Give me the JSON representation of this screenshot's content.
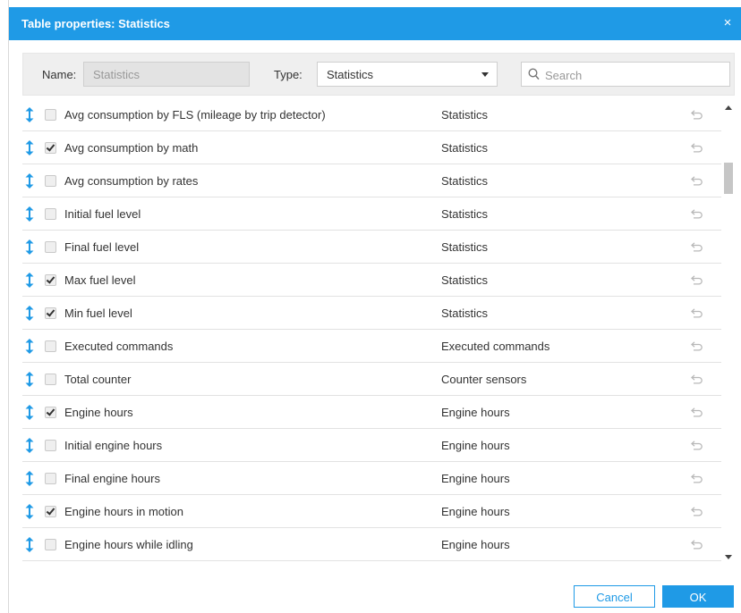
{
  "dialog": {
    "title": "Table properties: Statistics",
    "close_symbol": "×"
  },
  "filters": {
    "name_label": "Name:",
    "name_value": "Statistics",
    "type_label": "Type:",
    "type_value": "Statistics",
    "search_placeholder": "Search"
  },
  "rows": [
    {
      "name": "Avg consumption by FLS (mileage by trip detector)",
      "type": "Statistics",
      "checked": false
    },
    {
      "name": "Avg consumption by math",
      "type": "Statistics",
      "checked": true
    },
    {
      "name": "Avg consumption by rates",
      "type": "Statistics",
      "checked": false
    },
    {
      "name": "Initial fuel level",
      "type": "Statistics",
      "checked": false
    },
    {
      "name": "Final fuel level",
      "type": "Statistics",
      "checked": false
    },
    {
      "name": "Max fuel level",
      "type": "Statistics",
      "checked": true
    },
    {
      "name": "Min fuel level",
      "type": "Statistics",
      "checked": true
    },
    {
      "name": "Executed commands",
      "type": "Executed commands",
      "checked": false
    },
    {
      "name": "Total counter",
      "type": "Counter sensors",
      "checked": false
    },
    {
      "name": "Engine hours",
      "type": "Engine hours",
      "checked": true
    },
    {
      "name": "Initial engine hours",
      "type": "Engine hours",
      "checked": false
    },
    {
      "name": "Final engine hours",
      "type": "Engine hours",
      "checked": false
    },
    {
      "name": "Engine hours in motion",
      "type": "Engine hours",
      "checked": true
    },
    {
      "name": "Engine hours while idling",
      "type": "Engine hours",
      "checked": false
    }
  ],
  "footer": {
    "cancel_label": "Cancel",
    "ok_label": "OK"
  },
  "icons": {
    "drag": "drag-handle-icon",
    "reset": "reset-icon",
    "search": "search-icon"
  },
  "colors": {
    "accent": "#1f9ae6",
    "reset_icon": "#b8b8b8"
  }
}
